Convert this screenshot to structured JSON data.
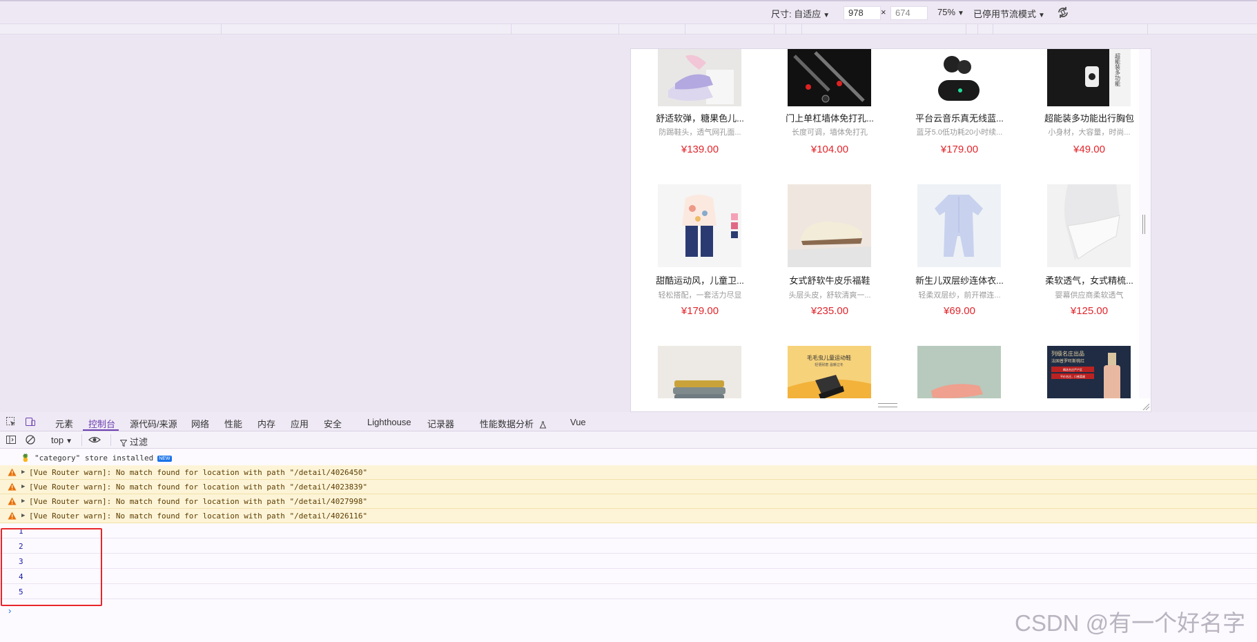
{
  "device_toolbar": {
    "size_label": "尺寸: 自适应",
    "width_value": "978",
    "times": "×",
    "height_value": "674",
    "zoom": "75%",
    "throttle": "已停用节流模式"
  },
  "products": [
    {
      "name": "舒适软弹，糖果色儿...",
      "desc": "防踢鞋头，透气网孔面...",
      "price": "¥139.00"
    },
    {
      "name": "门上单杠墙体免打孔...",
      "desc": "长度可调，墙体免打孔",
      "price": "¥104.00"
    },
    {
      "name": "平台云音乐真无线蓝...",
      "desc": "蓝牙5.0低功耗20小时续...",
      "price": "¥179.00"
    },
    {
      "name": "超能装多功能出行胸包",
      "desc": "小身材，大容量，时尚...",
      "price": "¥49.00"
    },
    {
      "name": "甜酷运动风，儿童卫...",
      "desc": "轻松搭配，一套活力尽显",
      "price": "¥179.00"
    },
    {
      "name": "女式舒软牛皮乐福鞋",
      "desc": "头层头皮，舒软清爽一...",
      "price": "¥235.00"
    },
    {
      "name": "新生儿双层纱连体衣...",
      "desc": "轻柔双层纱，前开襟连...",
      "price": "¥69.00"
    },
    {
      "name": "柔软透气，女式精梳...",
      "desc": "婴幕供应商柔软透气",
      "price": "¥125.00"
    }
  ],
  "image_texts": {
    "shoe_banner_title": "毛毛虫儿童运动鞋",
    "shoe_banner_sub": "轻便耐磨 温暖过冬",
    "wine_title": "列级名庄出品",
    "wine_sub": "法国普罗旺斯桃红",
    "wine_tag1": "精选名庄严产区",
    "wine_tag2": "平价名庄，口感柔顺",
    "bag_side_text": "超能装多功能"
  },
  "devtools": {
    "tabs": [
      "元素",
      "控制台",
      "源代码/来源",
      "网络",
      "性能",
      "内存",
      "应用",
      "安全",
      "Lighthouse",
      "记录器",
      "性能数据分析",
      "Vue"
    ],
    "active_tab": "控制台",
    "context": "top",
    "filter_label": "过滤"
  },
  "console": {
    "info_message": "\"category\" store installed",
    "new_badge": "NEW",
    "warnings": [
      "[Vue Router warn]: No match found for location with path \"/detail/4026450\"",
      "[Vue Router warn]: No match found for location with path \"/detail/4023839\"",
      "[Vue Router warn]: No match found for location with path \"/detail/4027998\"",
      "[Vue Router warn]: No match found for location with path \"/detail/4026116\""
    ],
    "numbers": [
      "1",
      "2",
      "3",
      "4",
      "5"
    ],
    "prompt": "›"
  },
  "watermark": "CSDN @有一个好名字",
  "colors": {
    "accent": "#6b3fb0",
    "price": "#e1252b",
    "highlight": "#e8252a",
    "warning_bg": "#fdf4d7"
  },
  "icons": [
    "inspect-icon",
    "device-icon",
    "sidebar-icon",
    "clear-icon",
    "eye-icon",
    "filter-icon",
    "rotate-icon",
    "warning-icon",
    "flask-icon"
  ]
}
